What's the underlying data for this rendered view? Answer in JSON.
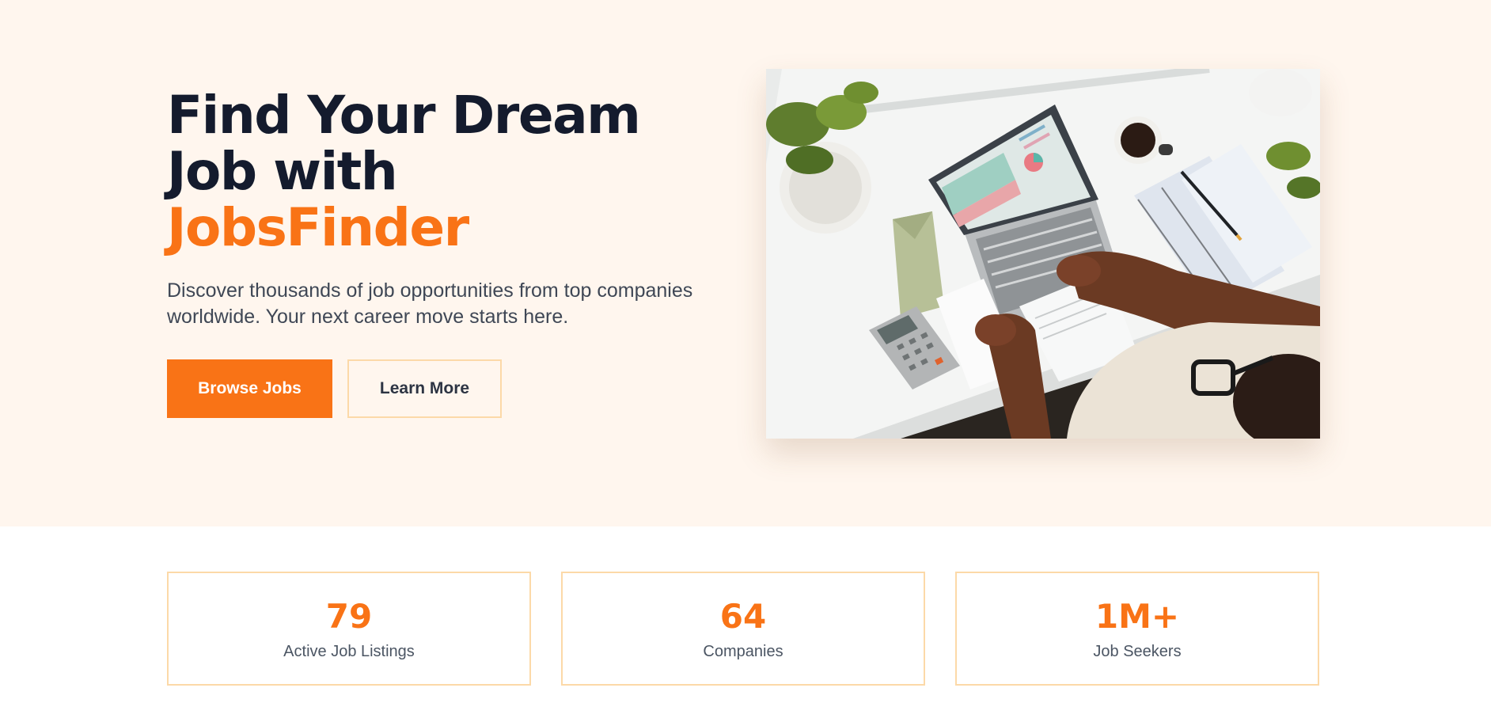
{
  "hero": {
    "title_line1": "Find Your Dream",
    "title_line2": "Job with",
    "title_accent": "JobsFinder",
    "description": "Discover thousands of job opportunities from top companies worldwide. Your next career move starts here.",
    "primary_button": "Browse Jobs",
    "secondary_button": "Learn More"
  },
  "stats": [
    {
      "value": "79",
      "label": "Active Job Listings"
    },
    {
      "value": "64",
      "label": "Companies"
    },
    {
      "value": "1M+",
      "label": "Job Seekers"
    }
  ],
  "colors": {
    "accent": "#f97316",
    "hero_background": "#fff6ee",
    "heading": "#141b2d",
    "card_border": "#fcd9a8"
  }
}
